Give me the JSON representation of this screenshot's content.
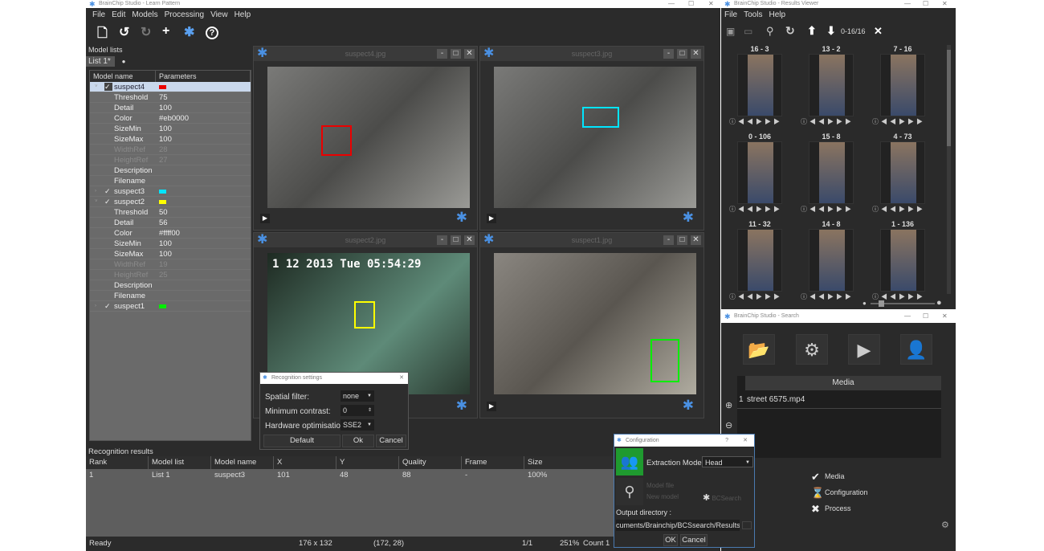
{
  "learn": {
    "title": "BrainChip Studio - Learn Pattern",
    "menu": [
      "File",
      "Edit",
      "Models",
      "Processing",
      "View",
      "Help"
    ],
    "toolbar": [
      "new-file-icon",
      "undo-icon",
      "redo-icon",
      "add-icon",
      "brainchip-icon",
      "help-icon"
    ],
    "model_lists_label": "Model lists",
    "tab": "List 1*",
    "col_model": "Model name",
    "col_params": "Parameters",
    "models": [
      {
        "name": "suspect4",
        "color": "#eb0000",
        "expanded": true,
        "selected": true,
        "params": [
          [
            "Threshold",
            "75"
          ],
          [
            "Detail",
            "100"
          ],
          [
            "Color",
            "#eb0000"
          ],
          [
            "SizeMin",
            "100"
          ],
          [
            "SizeMax",
            "100"
          ],
          [
            "WidthRef",
            "28"
          ],
          [
            "HeightRef",
            "27"
          ],
          [
            "Description",
            ""
          ],
          [
            "Filename",
            ""
          ]
        ]
      },
      {
        "name": "suspect3",
        "color": "#00e5ff",
        "expanded": false,
        "params": []
      },
      {
        "name": "suspect2",
        "color": "#ffff00",
        "expanded": true,
        "params": [
          [
            "Threshold",
            "50"
          ],
          [
            "Detail",
            "56"
          ],
          [
            "Color",
            "#ffff00"
          ],
          [
            "SizeMin",
            "100"
          ],
          [
            "SizeMax",
            "100"
          ],
          [
            "WidthRef",
            "19"
          ],
          [
            "HeightRef",
            "25"
          ],
          [
            "Description",
            ""
          ],
          [
            "Filename",
            ""
          ]
        ]
      },
      {
        "name": "suspect1",
        "color": "#00ee00",
        "expanded": false,
        "params": []
      }
    ],
    "videos": [
      {
        "title": "suspect4.jpg",
        "box": "#eb0000"
      },
      {
        "title": "suspect3.jpg",
        "box": "#00e5ff"
      },
      {
        "title": "suspect2.jpg",
        "box": "#ffff00",
        "overlay": "1 12 2013 Tue 05:54:29"
      },
      {
        "title": "suspect1.jpg",
        "box": "#00ee00"
      }
    ],
    "results_label": "Recognition results",
    "results_cols": [
      "Rank",
      "Model list",
      "Model name",
      "X",
      "Y",
      "Quality",
      "Frame",
      "Size"
    ],
    "results_rows": [
      [
        "1",
        "List 1",
        "suspect3",
        "101",
        "48",
        "88",
        "-",
        "100%"
      ]
    ],
    "status": {
      "state": "Ready",
      "dims": "176 x 132",
      "coords": "(172, 28)",
      "page": "1/1",
      "zoom": "251%",
      "count": "Count 1"
    }
  },
  "recog": {
    "title": "Recognition settings",
    "spatial_label": "Spatial filter:",
    "spatial": "none",
    "contrast_label": "Minimum contrast:",
    "contrast": "0",
    "hw_label": "Hardware optimisation:",
    "hw": "SSE2",
    "default": "Default",
    "ok": "Ok",
    "cancel": "Cancel"
  },
  "viewer": {
    "title": "BrainChip Studio - Results Viewer",
    "menu": [
      "File",
      "Tools",
      "Help"
    ],
    "range": "0-16/16",
    "thumbs": [
      "16 - 3",
      "13 - 2",
      "7 - 16",
      "0 - 106",
      "15 - 8",
      "4 - 73",
      "11 - 32",
      "14 - 8",
      "1 - 136"
    ]
  },
  "search": {
    "title": "BrainChip Studio - Search",
    "media_header": "Media",
    "media": [
      {
        "idx": "1",
        "name": "street 6575.mp4"
      }
    ],
    "steps": [
      {
        "icon": "check-icon",
        "label": "Media"
      },
      {
        "icon": "hourglass-icon",
        "label": "Configuration"
      },
      {
        "icon": "x-icon",
        "label": "Process"
      }
    ]
  },
  "config": {
    "title": "Configuration",
    "help": "?",
    "mode_label": "Extraction Mode",
    "mode": "Head",
    "model_file": "Model file",
    "new_model": "New model",
    "bcsearch": "BCSearch",
    "out_label": "Output directory :",
    "out": "cuments/Brainchip/BCSsearch/Results/",
    "ok": "OK",
    "cancel": "Cancel"
  }
}
